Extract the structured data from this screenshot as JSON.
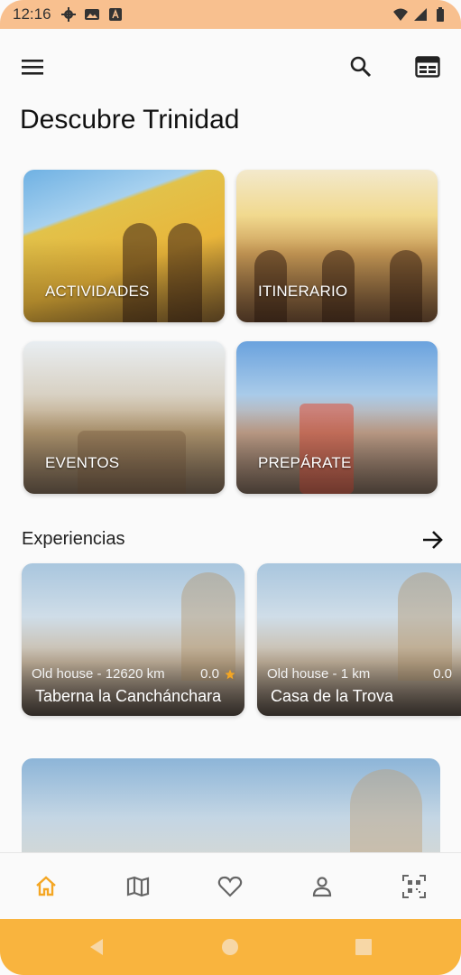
{
  "status_bar": {
    "time": "12:16",
    "left_icons": [
      "gear-icon",
      "photo-icon",
      "a-letter-icon"
    ],
    "right_icons": [
      "wifi-icon",
      "signal-icon",
      "battery-icon"
    ],
    "background": "#f8c08f"
  },
  "app_bar": {
    "icons": [
      "menu-icon",
      "search-icon",
      "calendar-icon"
    ]
  },
  "page": {
    "title": "Descubre Trinidad"
  },
  "tiles": [
    {
      "label": "ACTIVIDADES"
    },
    {
      "label": "ITINERARIO"
    },
    {
      "label": "EVENTOS"
    },
    {
      "label": "PREPÁRATE"
    }
  ],
  "experiences": {
    "title": "Experiencias",
    "items": [
      {
        "meta": "Old house - 12620 km",
        "rating": "0.0",
        "name": "Taberna  la Canchánchara"
      },
      {
        "meta": "Old house - 1 km",
        "rating": "0.0",
        "name": "Casa de la Trova"
      }
    ]
  },
  "bottom_nav": {
    "items": [
      "home-icon",
      "map-icon",
      "heart-icon",
      "profile-icon",
      "qr-icon"
    ],
    "active": "home-icon",
    "active_color": "#f4a623"
  },
  "system_nav": {
    "background": "#f9b43e",
    "buttons": [
      "back-icon",
      "home-circle-icon",
      "recents-icon"
    ]
  }
}
